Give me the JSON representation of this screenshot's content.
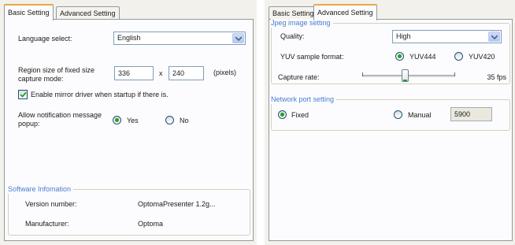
{
  "left": {
    "tabs": [
      {
        "label": "Basic Setting",
        "active": true
      },
      {
        "label": "Advanced Setting",
        "active": false
      }
    ],
    "language": {
      "label": "Language select:",
      "value": "English"
    },
    "region": {
      "label": "Region size of fixed size capture mode:",
      "width": "336",
      "separator": "x",
      "height": "240",
      "unit": "(pixels)"
    },
    "mirror": {
      "label": "Enable mirror driver when startup if there is.",
      "checked": true
    },
    "popup": {
      "label": "Allow notification message popup:",
      "options": [
        {
          "label": "Yes",
          "selected": true
        },
        {
          "label": "No",
          "selected": false
        }
      ]
    },
    "software_info": {
      "title": "Software Infomation",
      "version_label": "Version number:",
      "version_value": "OptomaPresenter 1.2g...",
      "manufacturer_label": "Manufacturer:",
      "manufacturer_value": "Optoma"
    }
  },
  "right": {
    "tabs": [
      {
        "label": "Basic Setting",
        "active": false
      },
      {
        "label": "Advanced Setting",
        "active": true
      }
    ],
    "jpeg": {
      "title": "Jpeg image setting",
      "quality_label": "Quality:",
      "quality_value": "High",
      "yuv_label": "YUV sample format:",
      "yuv_options": [
        {
          "label": "YUV444",
          "selected": true
        },
        {
          "label": "YUV420",
          "selected": false
        }
      ]
    },
    "capture": {
      "label": "Capture rate:",
      "value_text": "35 fps",
      "level": 0.46
    },
    "network": {
      "title": "Network port setting",
      "options": [
        {
          "label": "Fixed",
          "selected": true
        },
        {
          "label": "Manual",
          "selected": false
        }
      ],
      "port": "5900"
    }
  },
  "colors": {
    "accent_green": "#21a121",
    "group_title_blue": "#4a7cd0",
    "tab_highlight": "#e9a94a"
  }
}
